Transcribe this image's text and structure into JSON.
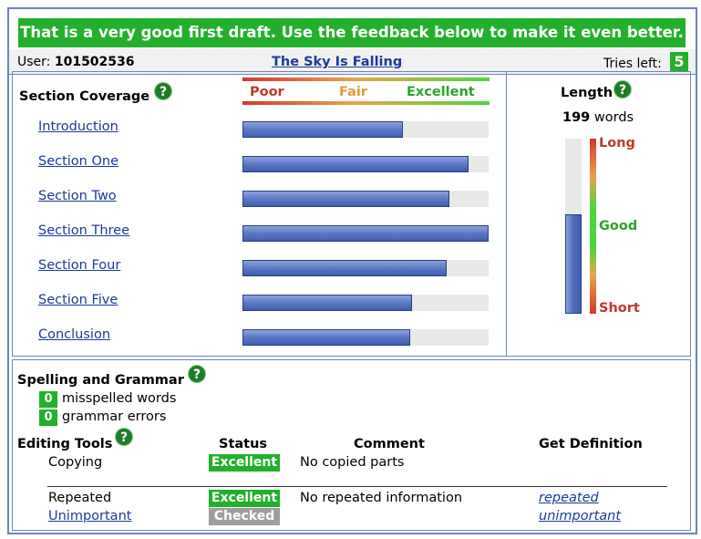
{
  "banner": {
    "text": "That is a very good first draft. Use the feedback below to make it even better."
  },
  "topbar": {
    "user_label": "User:",
    "user_id": "101502536",
    "doc_title": "The Sky Is Falling",
    "tries_label": "Tries left:",
    "tries_value": "5"
  },
  "coverage": {
    "heading": "Section Coverage",
    "help": "?",
    "scale": {
      "poor": "Poor",
      "fair": "Fair",
      "excellent": "Excellent"
    },
    "sections": [
      {
        "label": "Introduction",
        "fill": 0.65
      },
      {
        "label": "Section One",
        "fill": 0.92
      },
      {
        "label": "Section Two",
        "fill": 0.84
      },
      {
        "label": "Section Three",
        "fill": 1.0
      },
      {
        "label": "Section Four",
        "fill": 0.83
      },
      {
        "label": "Section Five",
        "fill": 0.69
      },
      {
        "label": "Conclusion",
        "fill": 0.68
      }
    ]
  },
  "length": {
    "heading": "Length",
    "help": "?",
    "word_count": "199",
    "words_label": "words",
    "fill": 0.57,
    "long": "Long",
    "good": "Good",
    "short": "Short"
  },
  "spelling": {
    "heading": "Spelling and Grammar",
    "help": "?",
    "misspelled_count": "0",
    "misspelled_label": "misspelled words",
    "grammar_count": "0",
    "grammar_label": "grammar errors"
  },
  "tools": {
    "heading": "Editing Tools",
    "help": "?",
    "col_status": "Status",
    "col_comment": "Comment",
    "col_definition": "Get Definition",
    "rows": [
      {
        "label": "Copying",
        "status": "Excellent",
        "comment": "No copied parts",
        "definition": ""
      },
      {
        "label": "Repeated",
        "status": "Excellent",
        "comment": "No repeated information",
        "definition": "repeated"
      },
      {
        "label": "Unimportant",
        "status": "Checked",
        "comment": "",
        "definition": "unimportant"
      }
    ]
  },
  "colors": {
    "banner_green": "#22b02b",
    "border_blue": "#6a86b9",
    "link_blue": "#1a3a9c",
    "checked_gray": "#9e9e9e"
  }
}
